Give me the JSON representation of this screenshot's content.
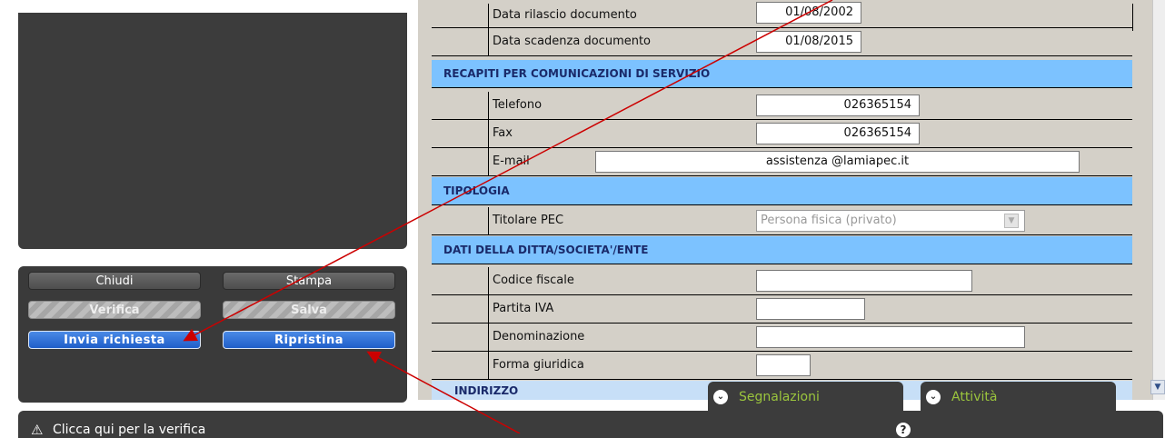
{
  "buttons": {
    "close": "Chiudi",
    "print": "Stampa",
    "verify": "Verifica",
    "save": "Salva",
    "send": "Invia richiesta",
    "reset": "Ripristina"
  },
  "form": {
    "doc_issue_label": "Data rilascio documento",
    "doc_issue_value": "01/08/2002",
    "doc_expiry_label": "Data scadenza documento",
    "doc_expiry_value": "01/08/2015",
    "contacts_header": "RECAPITI PER COMUNICAZIONI DI SERVIZIO",
    "phone_label": "Telefono",
    "phone_value": "026365154",
    "fax_label": "Fax",
    "fax_value": "026365154",
    "email_label": "E-mail",
    "email_value": "assistenza @lamiapec.it",
    "typology_header": "TIPOLOGIA",
    "holder_label": "Titolare PEC",
    "holder_value": "Persona fisica (privato)",
    "company_header": "DATI DELLA DITTA/SOCIETA'/ENTE",
    "tax_code_label": "Codice fiscale",
    "vat_label": "Partita IVA",
    "name_label": "Denominazione",
    "legal_form_label": "Forma giuridica",
    "address_header": "INDIRIZZO"
  },
  "tabs": {
    "reports": "Segnalazioni",
    "activities": "Attività"
  },
  "status_bar": {
    "hint": "Clicca qui per la verifica",
    "help": "?"
  },
  "icons": {
    "warning": "warning-icon",
    "help": "help-icon",
    "tab": "pin-icon"
  },
  "colors": {
    "section_header": "#7cc2ff",
    "form_bg": "#d4d0c8",
    "panel_dark": "#3c3c3c",
    "primary_button": "#2b6bd6",
    "tab_text": "#9bc53d",
    "annotation_arrow": "#cc0000"
  }
}
